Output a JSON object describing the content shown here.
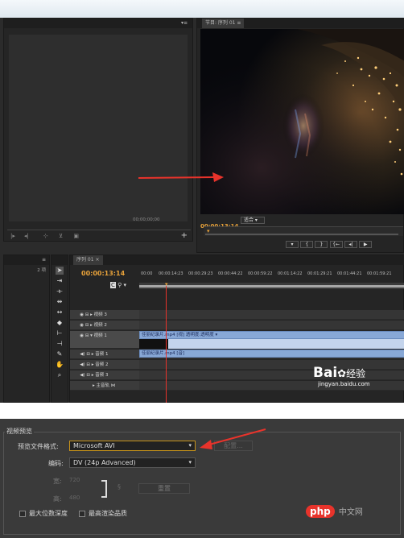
{
  "premiere": {
    "source_panel": {
      "timecode": "00;00;00;00",
      "tab_menu": "▾≡"
    },
    "program_panel": {
      "tab_title": "节目: 序列 01",
      "tab_menu": "≡",
      "timecode": "00:00:13:14",
      "fit_label": "适合"
    },
    "timeline": {
      "tab_title": "序列 01",
      "tab_close": "×",
      "project_count": "2 项",
      "timecode": "00:00:13:14",
      "ruler_labels": [
        "00:00",
        "00:00:14:23",
        "00:00:29:23",
        "00:00:44:22",
        "00:00:59:22",
        "00:01:14:22",
        "00:01:29:21",
        "00:01:44:21",
        "00:01:59:21"
      ],
      "tracks": {
        "video3": "▸ 视频 3",
        "video2": "▸ 视频 2",
        "video1": "▾ 视频 1",
        "audio1": "▸ 音频 1",
        "audio2": "▸ 音频 2",
        "audio3": "▸ 音频 3",
        "master": "▸ 主音轨"
      },
      "video_clip_label": "佳丽纪录片.mp4 [视] 透明度:透明度 ▾",
      "audio_clip_label": "佳丽纪录片.mp4 [音]"
    },
    "watermark": {
      "brand": "Bai",
      "brand2": "经验",
      "url": "jingyan.baidu.com"
    }
  },
  "video_preview": {
    "section_title": "视频预览",
    "preview_format_label": "预览文件格式:",
    "preview_format_value": "Microsoft AVI",
    "config_button": "配置...",
    "codec_label": "编码:",
    "codec_value": "DV (24p Advanced)",
    "width_label": "宽:",
    "width_value": "720",
    "height_label": "高:",
    "height_value": "480",
    "reset_button": "重置",
    "max_bit_depth_label": "最大位数深度",
    "max_render_quality_label": "最高渲染品质",
    "watermark": {
      "brand": "php",
      "site": "中文网"
    }
  },
  "colors": {
    "accent_timecode": "#e8a23a",
    "arrow_red": "#e8332b",
    "clip_blue": "#88a8d6"
  }
}
